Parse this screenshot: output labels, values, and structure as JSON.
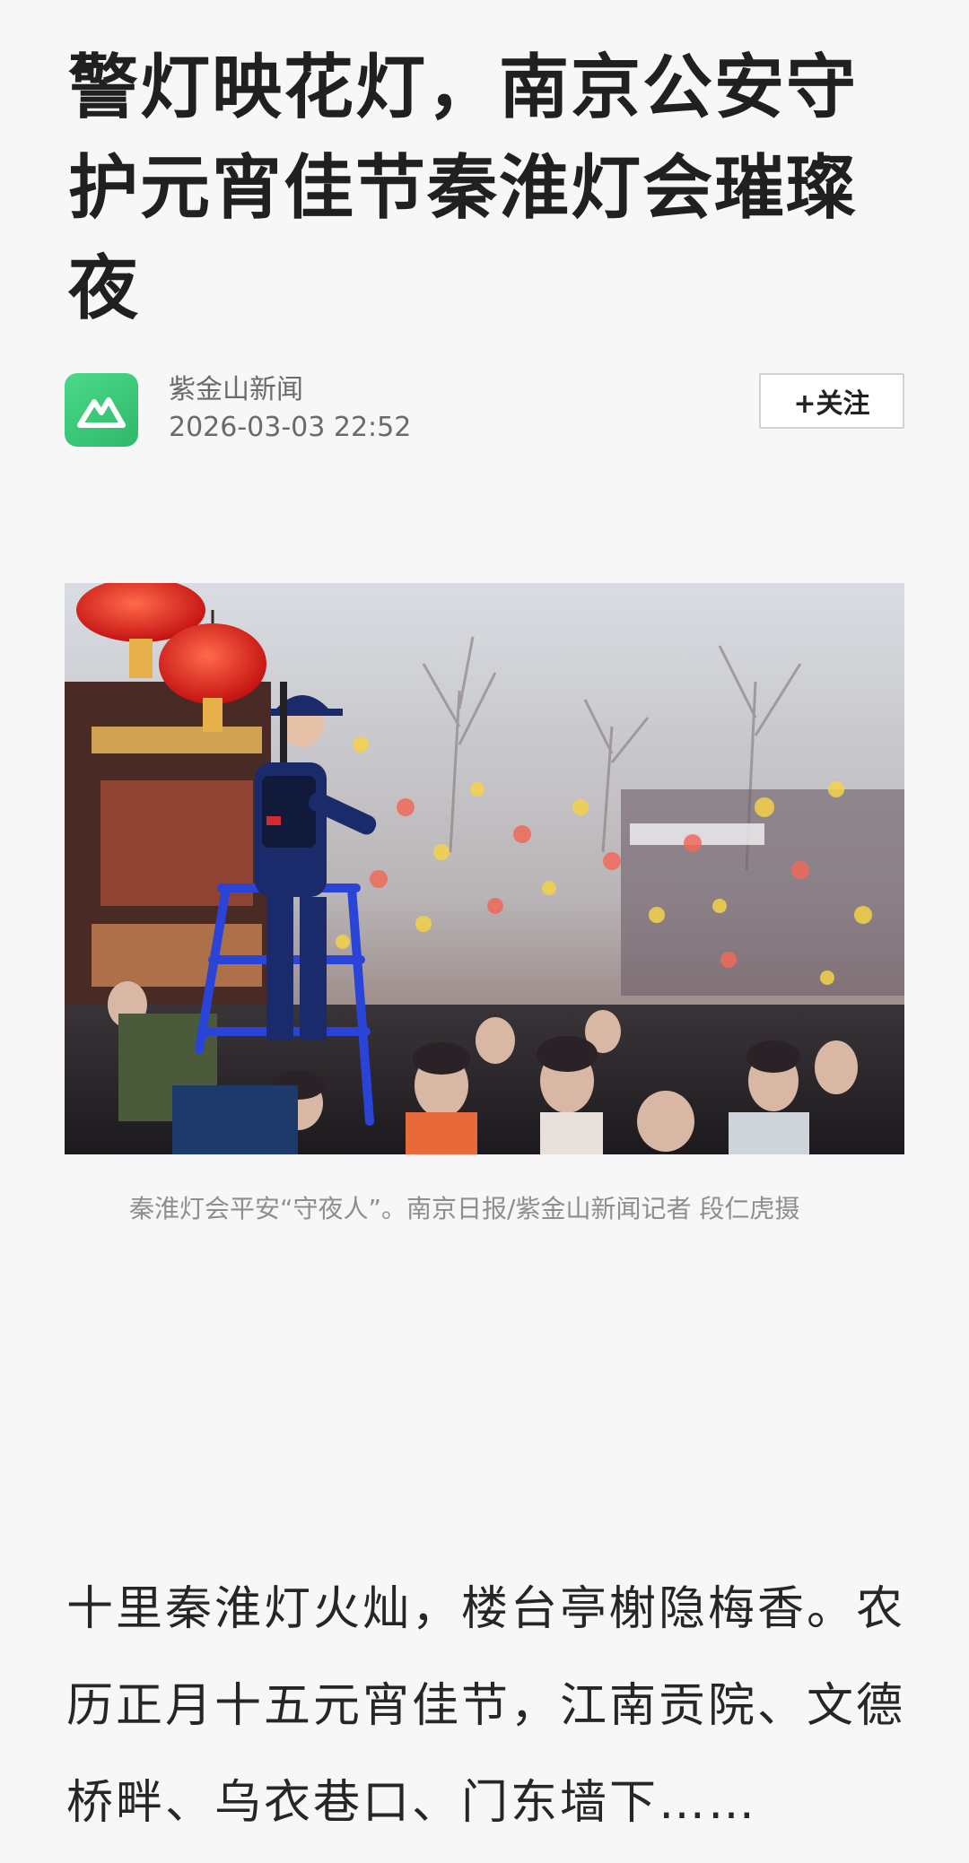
{
  "article": {
    "title": "警灯映花灯，南京公安守护元宵佳节秦淮灯会璀璨夜",
    "author": {
      "name": "紫金山新闻",
      "timestamp": "2026-03-03 22:52",
      "avatar_icon": "mountain-logo-icon",
      "avatar_color": "#3cc97a"
    },
    "follow_label": "+关注",
    "image_caption": "秦淮灯会平安“守夜人”。南京日报/紫金山新闻记者 段仁虎摄",
    "body": "十里秦淮灯火灿，楼台亭榭隐梅香。农历正月十五元宵佳节，江南贡院、文德桥畔、乌衣巷口、门东墙下……"
  },
  "colors": {
    "background": "#f7f7f8",
    "title": "#202020",
    "meta": "#6a6a6a",
    "caption": "#8e8e8e",
    "police_blue": "#1e3fb5"
  }
}
